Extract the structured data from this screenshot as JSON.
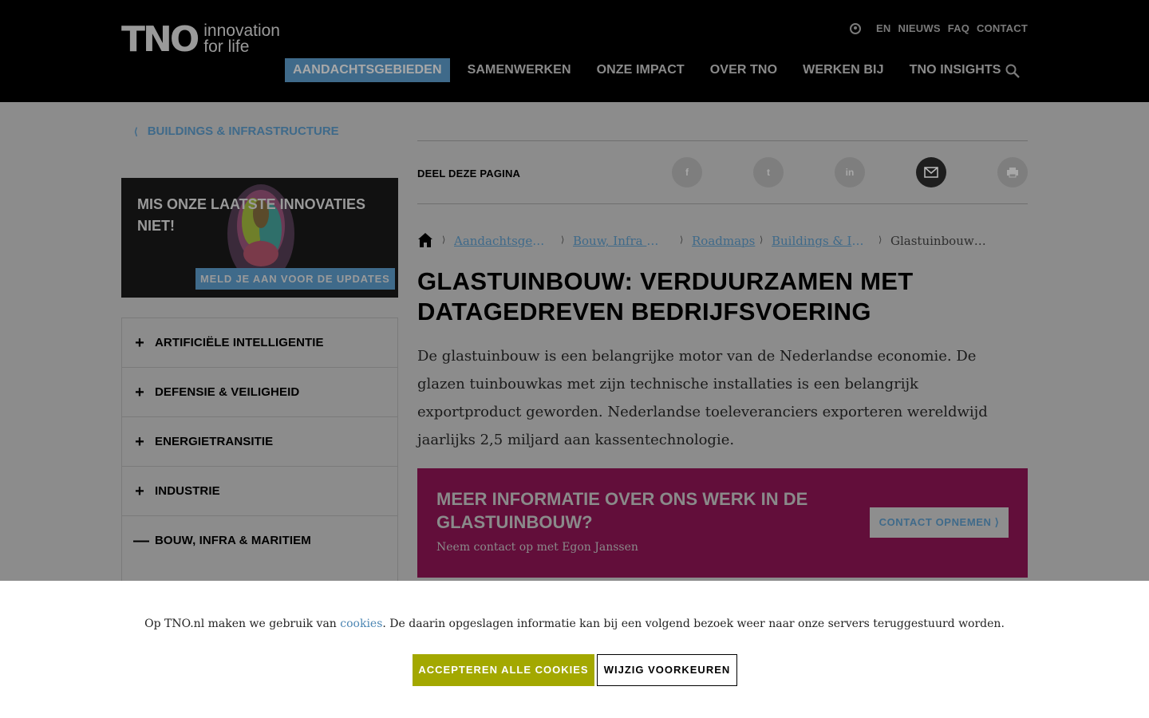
{
  "header": {
    "logo_mark": "TNO",
    "logo_tag_line1": "innovation",
    "logo_tag_line2": "for life",
    "util_nav": [
      "EN",
      "NIEUWS",
      "FAQ",
      "CONTACT"
    ],
    "main_nav": [
      "AANDACHTSGEBIEDEN",
      "SAMENWERKEN",
      "ONZE IMPACT",
      "OVER TNO",
      "WERKEN BIJ",
      "TNO INSIGHTS"
    ],
    "active_nav": "AANDACHTSGEBIEDEN"
  },
  "sidebar": {
    "back_link": "BUILDINGS & INFRASTRUCTURE",
    "promo": {
      "title": "MIS ONZE LAATSTE INNOVATIES NIET!",
      "button": "MELD JE AAN VOOR DE UPDATES"
    },
    "accordion": [
      {
        "sign": "+",
        "label": "ARTIFICIËLE INTELLIGENTIE"
      },
      {
        "sign": "+",
        "label": "DEFENSIE & VEILIGHEID"
      },
      {
        "sign": "+",
        "label": "ENERGIETRANSITIE"
      },
      {
        "sign": "+",
        "label": "INDUSTRIE"
      },
      {
        "sign": "—",
        "label": "BOUW, INFRA & MARITIEM"
      }
    ]
  },
  "share": {
    "label": "DEEL DEZE PAGINA",
    "buttons": [
      "facebook-icon",
      "twitter-icon",
      "linkedin-icon",
      "mail-icon",
      "print-icon"
    ]
  },
  "breadcrumb": [
    "Aandachtsgebieden",
    "Bouw, Infra & Maritiem",
    "Roadmaps",
    "Buildings & Infrastructure",
    "Glastuinbouw: verduurzamen met datagedreven bedrijfsvoering"
  ],
  "main": {
    "title": "GLASTUINBOUW: VERDUURZAMEN MET DATAGEDREVEN BEDRIJFSVOERING",
    "intro": "De glastuinbouw is een belangrijke motor van de Nederlandse economie. De glazen tuinbouwkas met zijn technische installaties is een belangrijk exportproduct geworden. Nederlandse toeleveranciers exporteren wereldwijd jaarlijks 2,5 miljard aan kassentechnologie.",
    "cta": {
      "title": "MEER INFORMATIE OVER ONS WERK IN DE GLASTUINBOUW?",
      "subtitle": "Neem contact op met Egon Janssen",
      "button": "CONTACT OPNEMEN ⟩"
    }
  },
  "cookie": {
    "text_before": "Op TNO.nl maken we gebruik van ",
    "link": "cookies",
    "text_after": ". De daarin opgeslagen informatie kan bij een volgend bezoek weer naar onze servers teruggestuurd  worden.",
    "accept": "ACCEPTEREN ALLE COOKIES",
    "preferences": "WIJZIG VOORKEUREN"
  },
  "colors": {
    "header_bg": "#000000",
    "accent_blue": "#3f6a8a",
    "cta_bg": "#620e3a",
    "accept_green": "#a3a800",
    "overlay_grey": "#8c8c8c"
  }
}
